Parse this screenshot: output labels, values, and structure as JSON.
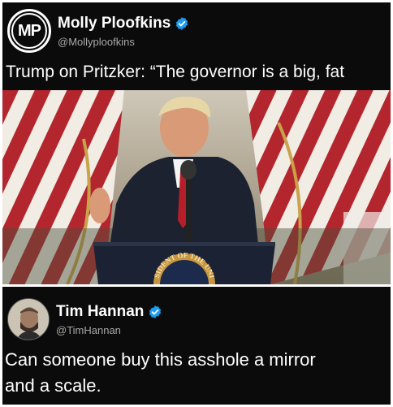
{
  "tweet1": {
    "avatar_initials": "MP",
    "display_name": "Molly Ploofkins",
    "handle": "@Mollyploofkins",
    "text": "Trump on Pritzker: “The governor is a big, fat slob.”",
    "image": {
      "seal_text": "SIDENT OF THE UNI"
    }
  },
  "tweet2": {
    "display_name": "Tim Hannan",
    "handle": "@TimHannan",
    "text_line1": "Can someone buy this asshole a mirror",
    "text_line2": "and a scale."
  },
  "colors": {
    "background": "#0b0b0b",
    "verified_blue": "#1d9bf0",
    "handle_gray": "#a9a9a9",
    "flag_red": "#b3262e",
    "podium": "#1b2233"
  },
  "icons": [
    "verified-badge-icon",
    "avatar-icon"
  ]
}
